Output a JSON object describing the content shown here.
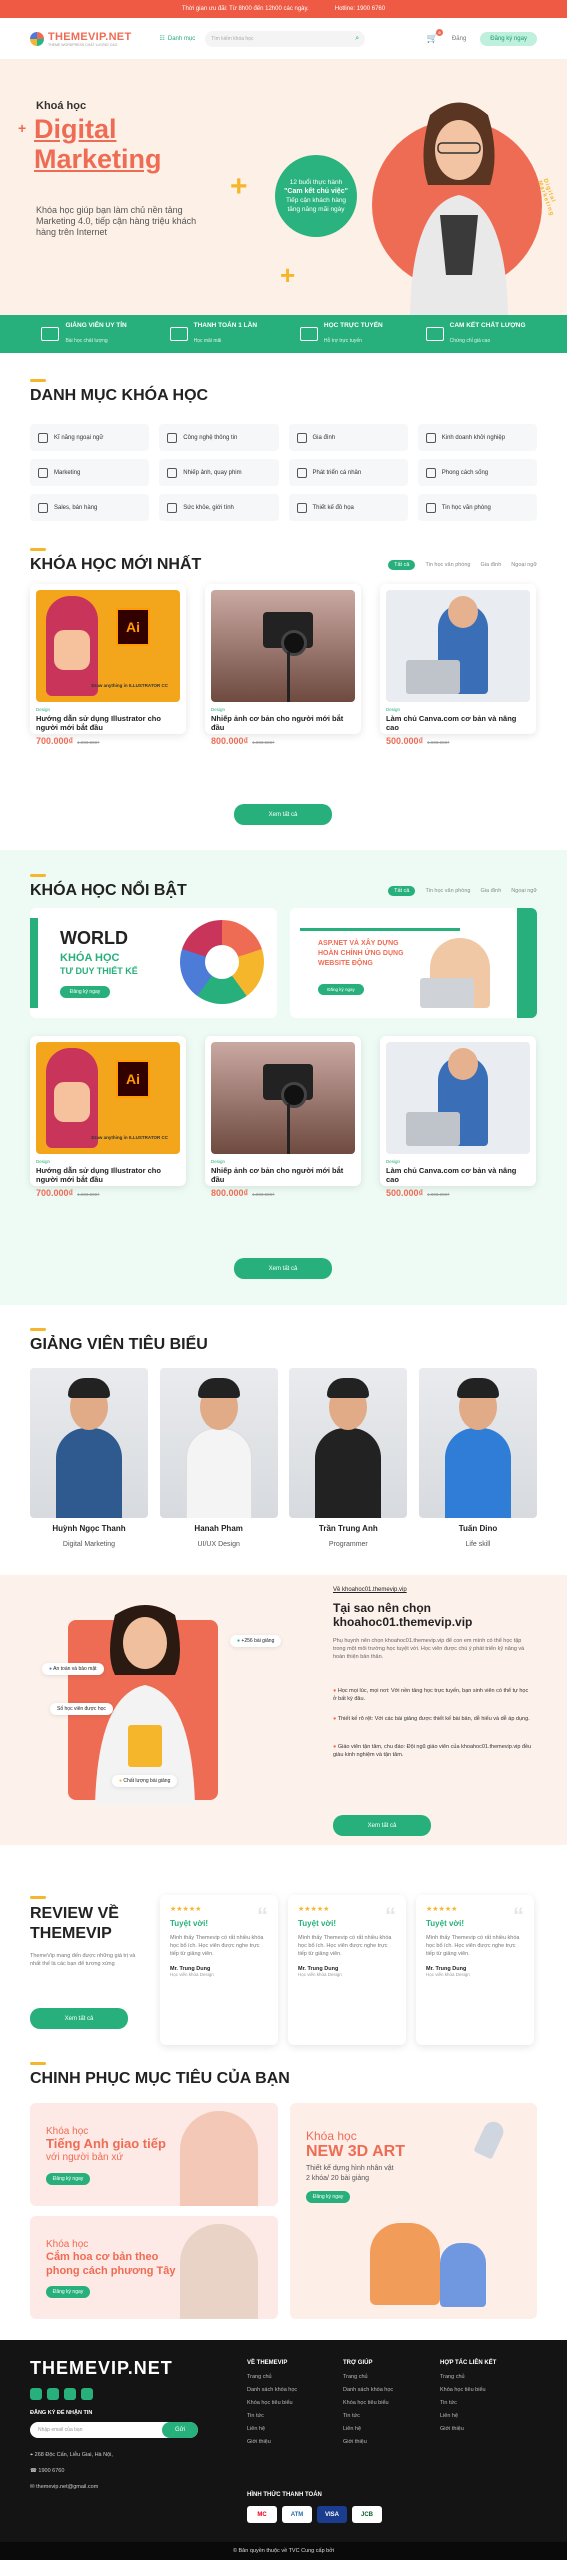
{
  "topbar": {
    "promo": "Thời gian ưu đãi: Từ 8h00 đến 12h00 các ngày.",
    "hotline": "Hotline: 1900 6760"
  },
  "header": {
    "logo_text": "THEMEVIP.NET",
    "logo_sub": "THEME WORDPRESS CHẤT LƯỢNG CAO",
    "category_label": "Danh mục",
    "search_placeholder": "Tìm kiếm khóa học",
    "cart_count": "0",
    "login_label": "Đăng",
    "register_label": "Đăng ký ngay"
  },
  "hero": {
    "kicker": "Khoá học",
    "title_line1": "Digital",
    "title_line2": "Marketing",
    "desc": "Khóa học giúp bạn làm chủ nền tảng Marketing 4.0, tiếp cận hàng triệu khách hàng trên Internet",
    "bubble_line1": "12 buổi thực hành",
    "bubble_line2": "\"Cam kết chủ việc\"",
    "bubble_line3": "Tiếp cận khách hàng",
    "bubble_line4": "tăng năng mãi ngày",
    "ring_text": "Digital Marketing"
  },
  "features": [
    {
      "title": "GIẢNG VIÊN UY TÍN",
      "sub": "Bài học chất lượng"
    },
    {
      "title": "THANH TOÁN 1 LẦN",
      "sub": "Học mãi mãi"
    },
    {
      "title": "HỌC TRỰC TUYẾN",
      "sub": "Hỗ trợ trực tuyến"
    },
    {
      "title": "CAM KẾT CHẤT LƯỢNG",
      "sub": "Chứng chỉ giá cao"
    }
  ],
  "categories": {
    "title": "DANH MỤC KHÓA HỌC",
    "items": [
      "Kĩ năng ngoại ngữ",
      "Công nghệ thông tin",
      "Gia đình",
      "Kinh doanh khởi nghiệp",
      "Marketing",
      "Nhiếp ảnh, quay phim",
      "Phát triển cá nhân",
      "Phong cách sống",
      "Sales, bán hàng",
      "Sức khỏe, giới tính",
      "Thiết kế đồ họa",
      "Tin học văn phòng"
    ]
  },
  "tabs": [
    "Tất cả",
    "Tin học văn phòng",
    "Gia đình",
    "Ngoại ngữ"
  ],
  "new_courses": {
    "title": "KHÓA HỌC MỚI NHẤT",
    "see_all": "Xem tất cả",
    "items": [
      {
        "tag": "Design",
        "title": "Hướng dẫn sử dụng Illustrator cho người mới bắt đầu",
        "price": "700.000₫",
        "old": "1.000.000₫",
        "ai_caption": "Draw anything in ILLUSTRATOR CC",
        "ai_logo": "Ai"
      },
      {
        "tag": "Design",
        "title": "Nhiếp ảnh cơ bản cho người mới bắt đầu",
        "price": "800.000₫",
        "old": "1.000.000₫"
      },
      {
        "tag": "Design",
        "title": "Làm chủ Canva.com cơ bản và nâng cao",
        "price": "500.000₫",
        "old": "1.000.000₫"
      }
    ]
  },
  "featured": {
    "title": "KHÓA HỌC NỔI BẬT",
    "see_all": "Xem tất cả",
    "banner1": {
      "line1": "WORLD",
      "line2": "KHÓA HỌC",
      "line3": "TƯ DUY THIẾT KẾ",
      "btn": "Đăng ký ngay"
    },
    "banner2": {
      "line1": "ASP.NET VÀ XÂY DỰNG",
      "line2": "HOÀN CHỈNH ỨNG DỤNG",
      "line3": "WEBSITE ĐỘNG",
      "btn": "Đăng ký ngay"
    },
    "items": [
      {
        "tag": "Design",
        "title": "Hướng dẫn sử dụng Illustrator cho người mới bắt đầu",
        "price": "700.000₫",
        "old": "1.000.000₫",
        "ai_caption": "Draw anything in ILLUSTRATOR CC",
        "ai_logo": "Ai"
      },
      {
        "tag": "Design",
        "title": "Nhiếp ảnh cơ bản cho người mới bắt đầu",
        "price": "800.000₫",
        "old": "1.000.000₫"
      },
      {
        "tag": "Design",
        "title": "Làm chủ Canva.com cơ bản và nâng cao",
        "price": "500.000₫",
        "old": "1.000.000₫"
      }
    ]
  },
  "teachers": {
    "title": "GIẢNG VIÊN TIÊU BIỂU",
    "items": [
      {
        "name": "Huỳnh Ngọc Thanh",
        "role": "Digital Marketing",
        "color": "#2f5a8f"
      },
      {
        "name": "Hanah Pham",
        "role": "UI/UX Design",
        "color": "#e8e8e8"
      },
      {
        "name": "Trần Trung Anh",
        "role": "Programmer",
        "color": "#222222"
      },
      {
        "name": "Tuấn Dino",
        "role": "Life skill",
        "color": "#2f7dd6"
      }
    ]
  },
  "why": {
    "link": "Về khoahoc01.themevip.vip",
    "title_line1": "Tại sao nên chọn",
    "title_line2": "khoahoc01.themevip.vip",
    "intro": "Phụ huynh nên chọn khoahoc01.themevip.vip để con em mình có thể học tập trong một môi trường học tuyệt vời. Học viên được chú ý phát triển kỹ năng và hoàn thiện bản thân.",
    "points": [
      "Học mọi lúc, mọi nơi: Với nền tảng học trực tuyến, bạn sinh viên có thể tự học ở bất kỳ đâu.",
      "Thiết kế rõ rệt: Với các bài giảng được thiết kế bài bản, dễ hiểu và dễ áp dụng.",
      "Giáo viên tận tâm, chu đáo: Đội ngũ giáo viên của khoahoc01.themevip.vip đều giàu kinh nghiệm và tận tâm."
    ],
    "btn": "Xem tất cả",
    "badge1": "+256 bài giảng",
    "badge2": "An toàn và bảo mật",
    "badge3": "Chất lượng bài giảng",
    "badge4": "Số học viên được học"
  },
  "reviews": {
    "title_line1": "REVIEW VỀ",
    "title_line2": "THEMEVIP",
    "desc": "ThemeVip mang đến được những giá trị và nhất thế là các bạn để tương xứng",
    "btn": "Xem tất cả",
    "items": [
      {
        "stars": "★★★★★",
        "title": "Tuyệt vời!",
        "text": "Mình thấy Themevip có rất nhiều khóa học bổ ích. Học viên được nghe trực tiếp từ giảng viên.",
        "name": "Mr. Trung Dung",
        "role": "Học viên khóa Design"
      },
      {
        "stars": "★★★★★",
        "title": "Tuyệt vời!",
        "text": "Mình thấy Themevip có rất nhiều khóa học bổ ích. Học viên được nghe trực tiếp từ giảng viên.",
        "name": "Mr. Trung Dung",
        "role": "Học viên khóa Design"
      },
      {
        "stars": "★★★★★",
        "title": "Tuyệt vời!",
        "text": "Mình thấy Themevip có rất nhiều khóa học bổ ích. Học viên được nghe trực tiếp từ giảng viên.",
        "name": "Mr. Trung Dung",
        "role": "Học viên khóa Design"
      }
    ]
  },
  "goals": {
    "title": "CHINH PHỤC MỤC TIÊU CỦA BẠN",
    "g1": {
      "line1": "Khóa học",
      "line2": "Tiếng Anh giao tiếp",
      "line3": "với người bản xứ",
      "btn": "Đăng ký ngay"
    },
    "g2": {
      "line1": "Khóa học",
      "line2": "Cắm hoa cơ bản theo",
      "line3": "phong cách phương Tây",
      "btn": "Đăng ký ngay"
    },
    "g3": {
      "line1": "Khóa học",
      "line2": "NEW 3D ART",
      "line3": "Thiết kế dựng hình nhân vật",
      "line4": "2 khóa/ 20 bài giảng",
      "btn": "Đăng ký ngay"
    }
  },
  "footer": {
    "logo": "THEMEVIP.NET",
    "newsletter_label": "ĐĂNG KÝ ĐỂ NHẬN TIN",
    "newsletter_placeholder": "Nhập email của bạn",
    "newsletter_btn": "Gửi",
    "address": "268 Độc Cấn, Liễu Giai, Hà Nội,",
    "phone": "1900 6760",
    "email": "themevip.net@gmail.com",
    "col1": {
      "title": "VỀ THEMEVIP",
      "links": [
        "Trang chủ",
        "Danh sách khóa học",
        "Khóa học tiêu biểu",
        "Tin tức",
        "Liên hệ",
        "Giới thiệu"
      ]
    },
    "col2": {
      "title": "TRỢ GIÚP",
      "links": [
        "Trang chủ",
        "Danh sách khóa học",
        "Khóa học tiêu biểu",
        "Tin tức",
        "Liên hệ",
        "Giới thiệu"
      ]
    },
    "col3": {
      "title": "HỢP TÁC LIÊN KẾT",
      "links": [
        "Trang chủ",
        "Khóa học tiêu biểu",
        "Tin tức",
        "Liên hệ",
        "Giới thiệu"
      ]
    },
    "pay_title": "HÌNH THỨC THANH TOÁN",
    "pay": [
      "MC",
      "ATM",
      "VISA",
      "JCB"
    ],
    "copyright": "© Bản quyền thuộc về TVC Cung cấp bởi"
  },
  "colors": {
    "accent": "#ef6c54",
    "green": "#27b07c",
    "yellow": "#f6b62b"
  }
}
